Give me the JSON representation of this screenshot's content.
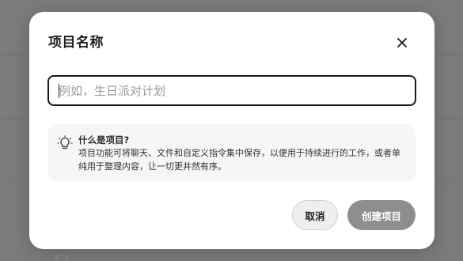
{
  "dialog": {
    "title": "项目名称",
    "close_icon": "close-icon"
  },
  "name_input": {
    "value": "",
    "placeholder": "例如，生日派对计划"
  },
  "info": {
    "icon": "lightbulb-icon",
    "title": "什么是项目?",
    "body": "项目功能可将聊天、文件和自定义指令集中保存，以便用于持续进行的工作，或者单纯用于整理内容，让一切更井然有序。"
  },
  "actions": {
    "cancel_label": "取消",
    "create_label": "创建项目"
  },
  "colors": {
    "overlay": "#7b7b7b",
    "modal_bg": "#ffffff",
    "create_button_disabled": "#8e8e8e",
    "cancel_button_bg": "#eeeeee",
    "info_box_bg": "#f6f6f6"
  }
}
